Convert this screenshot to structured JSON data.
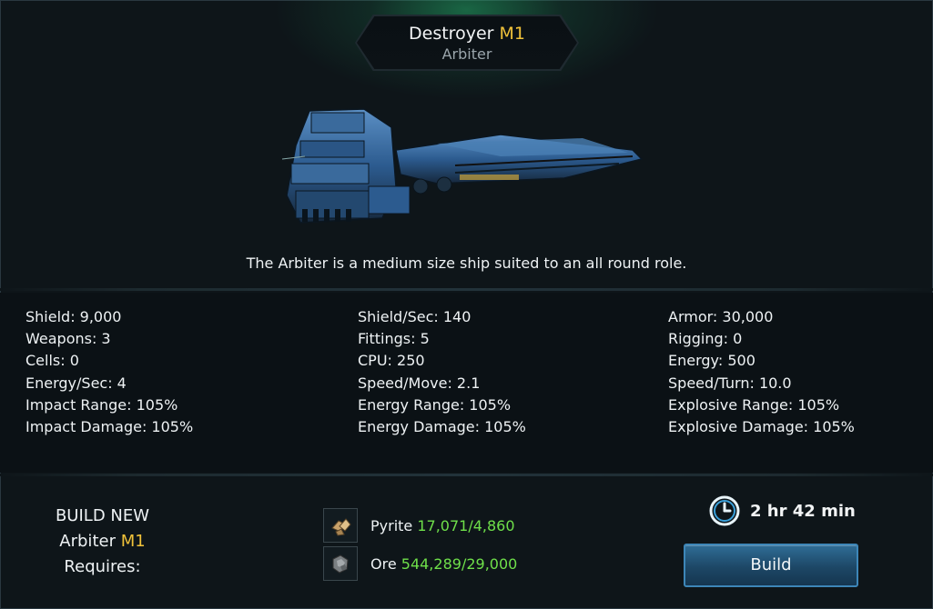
{
  "header": {
    "class_name": "Destroyer",
    "mark": "M1",
    "ship_name": "Arbiter"
  },
  "description": "The Arbiter is a medium size ship suited to an all round role.",
  "stats": {
    "col1": [
      "Shield: 9,000",
      "Weapons: 3",
      "Cells: 0",
      "Energy/Sec: 4",
      "Impact Range: 105%",
      "Impact Damage: 105%"
    ],
    "col2": [
      "Shield/Sec: 140",
      "Fittings: 5",
      "CPU: 250",
      "Speed/Move: 2.1",
      "Energy Range: 105%",
      "Energy Damage: 105%"
    ],
    "col3": [
      "Armor: 30,000",
      "Rigging: 0",
      "Energy: 500",
      "Speed/Turn: 10.0",
      "Explosive Range: 105%",
      "Explosive Damage: 105%"
    ]
  },
  "build": {
    "line1": "BUILD NEW",
    "ship_name": "Arbiter",
    "mark": "M1",
    "line3": "Requires:",
    "resources": [
      {
        "name": "Pyrite",
        "have": "17,071",
        "sep": "/",
        "need": "4,860",
        "icon": "pyrite-icon"
      },
      {
        "name": "Ore",
        "have": "544,289",
        "sep": "/",
        "need": "29,000",
        "icon": "ore-icon"
      }
    ],
    "time": "2 hr 42 min",
    "button_label": "Build"
  },
  "colors": {
    "accent": "#f0c23a",
    "resource_green": "#6fe04a",
    "button_blue": "#2f6d96"
  }
}
